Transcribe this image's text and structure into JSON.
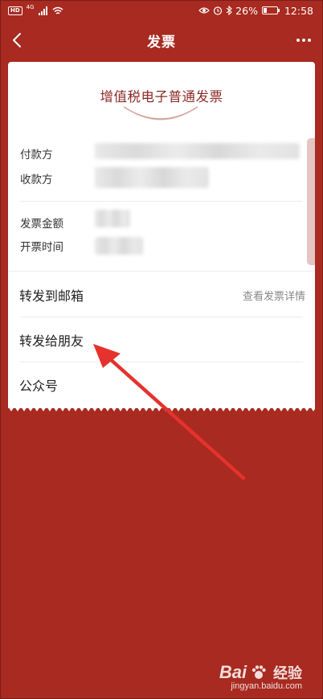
{
  "status_bar": {
    "hd": "HD",
    "signal_type": "4G",
    "battery_percent": "26%",
    "battery_level": 0.26,
    "time": "12:58"
  },
  "nav": {
    "title": "发票",
    "back_icon": "chevron-left-icon",
    "more_icon": "more-dots-icon"
  },
  "invoice": {
    "title": "增值税电子普通发票",
    "fields": [
      {
        "label": "付款方"
      },
      {
        "label": "收款方"
      },
      {
        "label": "发票金额"
      },
      {
        "label": "开票时间"
      }
    ]
  },
  "actions": {
    "email": {
      "label": "转发到邮箱",
      "detail_link": "查看发票详情"
    },
    "friend": {
      "label": "转发给朋友"
    },
    "official": {
      "label": "公众号"
    }
  },
  "watermark": {
    "brand": "Bai",
    "brand_suffix": "经验",
    "url": "jingyan.baidu.com"
  },
  "colors": {
    "background": "#a82a20",
    "invoice_title": "#8b2b25",
    "annotation_arrow": "#e5322d"
  }
}
